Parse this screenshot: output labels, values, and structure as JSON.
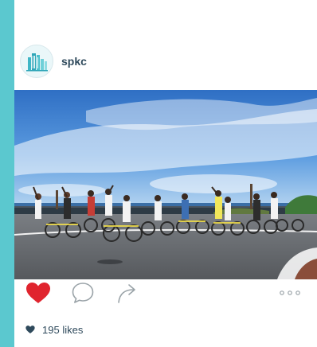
{
  "post": {
    "username": "spkc",
    "likes_count": "195",
    "likes_word": "likes"
  },
  "icons": {
    "avatar": "building-logo-icon",
    "like": "heart-filled-icon",
    "comment": "speech-bubble-icon",
    "share": "share-arrow-icon",
    "more": "more-dots-icon",
    "likes_marker": "small-heart-icon"
  },
  "colors": {
    "accent_bar": "#5bc8cf",
    "like_heart": "#e0242e",
    "text": "#2f4a5c",
    "icon_outline": "#9aa3a8",
    "likes_heart": "#2f4a5c"
  }
}
